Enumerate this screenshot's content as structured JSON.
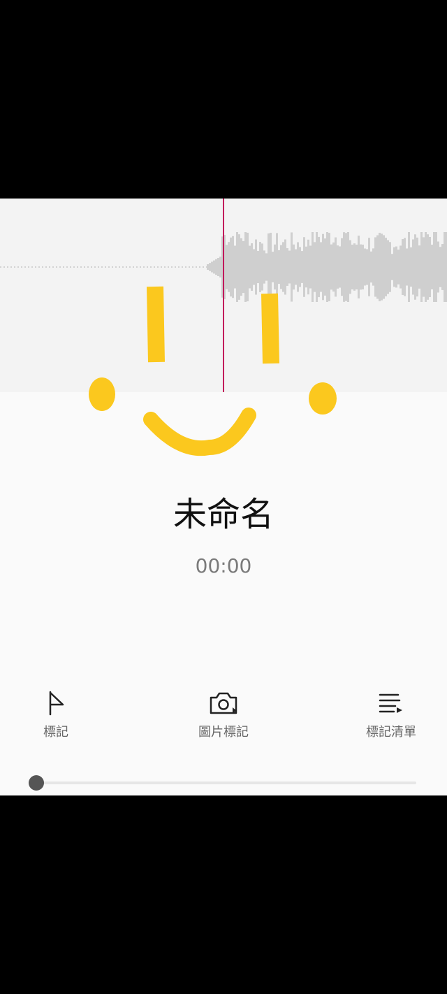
{
  "recording": {
    "title": "未命名",
    "elapsed": "00:00",
    "playhead_color": "#c2185b",
    "waveform_color": "#cfcfcf",
    "annotation_color": "#fbc81e"
  },
  "actions": [
    {
      "label": "標記",
      "icon": "flag-icon"
    },
    {
      "label": "圖片標記",
      "icon": "camera-icon"
    },
    {
      "label": "標記清單",
      "icon": "list-icon"
    }
  ],
  "playback": {
    "position_fraction": 0
  }
}
